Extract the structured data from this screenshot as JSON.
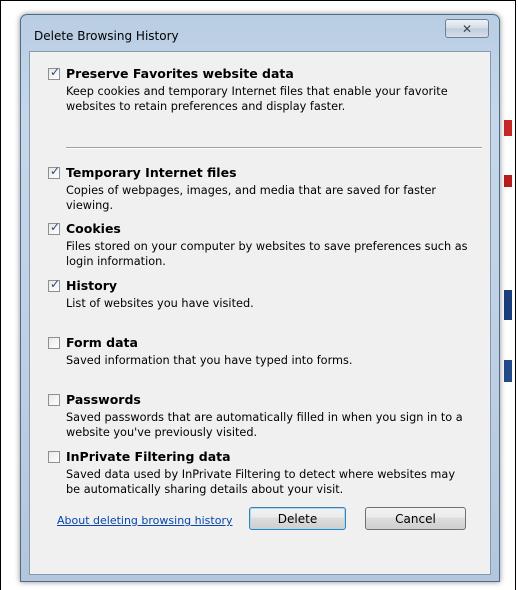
{
  "dialog": {
    "title": "Delete Browsing History",
    "close_symbol": "✕"
  },
  "options": [
    {
      "title": "Preserve Favorites website data",
      "checked": true,
      "description": "Keep cookies and temporary Internet files that enable your favorite websites to retain preferences and display faster."
    },
    {
      "title": "Temporary Internet files",
      "checked": true,
      "description": "Copies of webpages, images, and media that are saved for faster viewing."
    },
    {
      "title": "Cookies",
      "checked": true,
      "description": "Files stored on your computer by websites to save preferences such as login information."
    },
    {
      "title": "History",
      "checked": true,
      "description": "List of websites you have visited."
    },
    {
      "title": "Form data",
      "checked": false,
      "description": "Saved information that you have typed into forms."
    },
    {
      "title": "Passwords",
      "checked": false,
      "description": "Saved passwords that are automatically filled in when you sign in to a website you've previously visited."
    },
    {
      "title": "InPrivate Filtering data",
      "checked": false,
      "description": "Saved data used by InPrivate Filtering to detect where websites may be automatically sharing details about your visit."
    }
  ],
  "footer": {
    "help_link": "About deleting browsing history",
    "delete_label": "Delete",
    "cancel_label": "Cancel"
  }
}
